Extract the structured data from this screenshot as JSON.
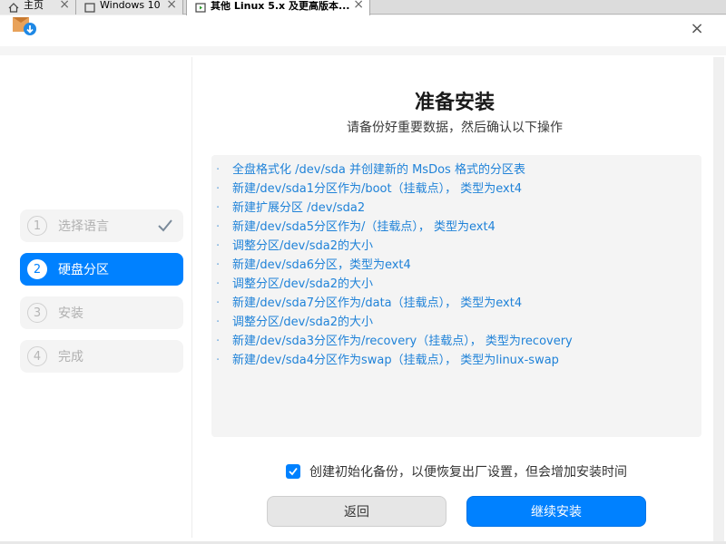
{
  "host_tabs": [
    {
      "label": "主页",
      "icon": "home-icon"
    },
    {
      "label": "Windows 10",
      "icon": "vm-window-icon"
    },
    {
      "label": "其他 Linux 5.x 及更高版本...",
      "icon": "vm-running-icon"
    }
  ],
  "tab_close": "×",
  "window": {
    "close_label": "×"
  },
  "steps": [
    {
      "num": "1",
      "label": "选择语言",
      "state": "done"
    },
    {
      "num": "2",
      "label": "硬盘分区",
      "state": "active"
    },
    {
      "num": "3",
      "label": "安装",
      "state": "pending"
    },
    {
      "num": "4",
      "label": "完成",
      "state": "pending"
    }
  ],
  "main": {
    "title": "准备安装",
    "subtitle": "请备份好重要数据，然后确认以下操作",
    "bullet": "·",
    "operations": [
      "全盘格式化 /dev/sda 并创建新的 MsDos 格式的分区表",
      "新建/dev/sda1分区作为/boot（挂载点）， 类型为ext4",
      "新建扩展分区 /dev/sda2",
      "新建/dev/sda5分区作为/（挂载点）， 类型为ext4",
      "调整分区/dev/sda2的大小",
      "新建/dev/sda6分区，类型为ext4",
      "调整分区/dev/sda2的大小",
      "新建/dev/sda7分区作为/data（挂载点）， 类型为ext4",
      "调整分区/dev/sda2的大小",
      "新建/dev/sda3分区作为/recovery（挂载点）， 类型为recovery",
      "新建/dev/sda4分区作为swap（挂载点）， 类型为linux-swap"
    ],
    "backup_checkbox": {
      "label": "创建初始化备份，以便恢复出厂设置，但会增加安装时间",
      "checked": true
    },
    "back_button": "返回",
    "continue_button": "继续安装"
  },
  "colors": {
    "accent": "#0081ff",
    "op_text": "#1f82d8"
  }
}
